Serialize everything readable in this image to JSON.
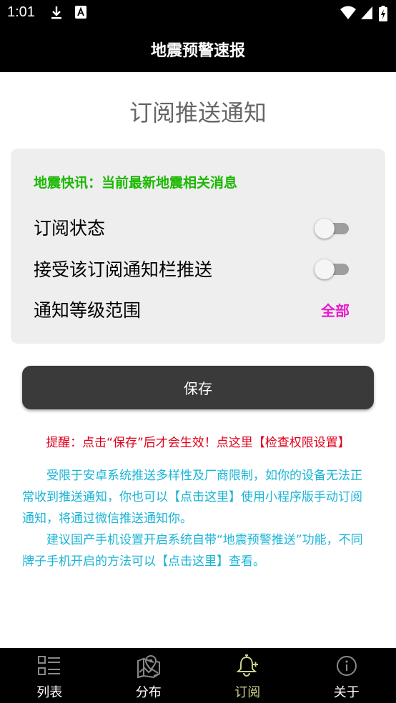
{
  "status_bar": {
    "time": "1:01"
  },
  "app_bar": {
    "title": "地震预警速报"
  },
  "page": {
    "heading": "订阅推送通知"
  },
  "card": {
    "subtitle": "地震快讯：当前最新地震相关消息",
    "rows": [
      {
        "label": "订阅状态",
        "toggle_on": false
      },
      {
        "label": "接受该订阅通知栏推送",
        "toggle_on": false
      }
    ],
    "level_row": {
      "label": "通知等级范围",
      "value": "全部"
    }
  },
  "save_button": {
    "label": "保存"
  },
  "notice": {
    "warning": "提醒：点击“保存”后才会生效！点这里【检查权限设置】",
    "para1": "受限于安卓系统推送多样性及厂商限制，如你的设备无法正常收到推送通知，你也可以【点击这里】使用小程序版手动订阅通知，将通过微信推送通知你。",
    "para2": "建议国产手机设置开启系统自带“地震预警推送”功能，不同牌子手机开启的方法可以【点击这里】查看。"
  },
  "bottom_nav": {
    "items": [
      {
        "label": "列表",
        "icon": "list-icon",
        "active": false
      },
      {
        "label": "分布",
        "icon": "map-icon",
        "active": false
      },
      {
        "label": "订阅",
        "icon": "bell-icon",
        "active": true
      },
      {
        "label": "关于",
        "icon": "info-icon",
        "active": false
      }
    ]
  },
  "colors": {
    "accent_green": "#1bb800",
    "magenta": "#e81ccd",
    "warning_red": "#e0001b",
    "info_cyan": "#1ab4d6",
    "nav_active": "#c9d38a"
  }
}
